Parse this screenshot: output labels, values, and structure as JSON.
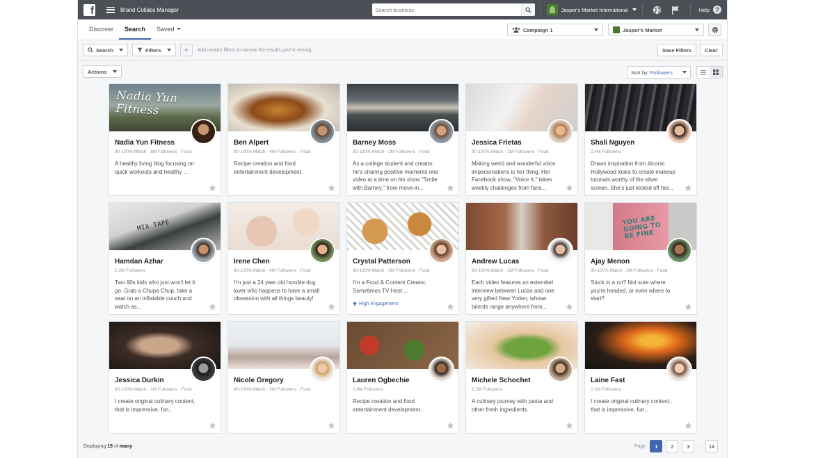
{
  "topbar": {
    "logo": "f",
    "app_title": "Brand Collabs Manager",
    "search_placeholder": "Search business",
    "account_name": "Jasper's Market International",
    "help_label": "Help",
    "help_icon": "?"
  },
  "tabs": [
    {
      "label": "Discover",
      "active": false
    },
    {
      "label": "Search",
      "active": true
    },
    {
      "label": "Saved",
      "active": false
    }
  ],
  "selectors": {
    "campaign": "Campaign 1",
    "page": "Jasper's Market"
  },
  "filterbar": {
    "search_label": "Search",
    "filters_label": "Filters",
    "add_symbol": "+",
    "hint": "Add creator filters to narrow the results you're seeing.",
    "save_filters": "Save Filters",
    "clear": "Clear"
  },
  "resultsbar": {
    "actions_label": "Actions",
    "sort_prefix": "Sort by:",
    "sort_value": "Followers"
  },
  "cards": [
    {
      "name": "Nadia Yun Fitness",
      "meta": "90-100% Match · 8M Followers · Food",
      "desc": "A healthy living blog focusing on quick workouts and healthy ...",
      "caption": "Nadia Yun Fitness",
      "tag": ""
    },
    {
      "name": "Ben Alpert",
      "meta": "90-100% Match · 4M Followers · Food",
      "desc": "Recipe creation and food entertainment development.",
      "caption": "",
      "tag": ""
    },
    {
      "name": "Barney Moss",
      "meta": "90-100% Match · 2M Followers · Food",
      "desc": "As a college student and creator, he's sharing positive moments one video at a time on his show \"Smile with Barney,\" from move-in...",
      "caption": "",
      "tag": ""
    },
    {
      "name": "Jessica Frietas",
      "meta": "90-100% Match · 2M Followers · Food",
      "desc": "Making weird and wonderful voice impersonations is her thing. Her Facebook show, \"Voice It,\" takes weekly challenges from fans...",
      "caption": "",
      "tag": ""
    },
    {
      "name": "Shali Nguyen",
      "meta": "2.4M Followers",
      "desc": "Draws inspiration from #iconic Hollywood looks to create makeup tutorials worthy of the silver screen. She's just kicked off her...",
      "caption": "",
      "tag": ""
    },
    {
      "name": "Hamdan Azhar",
      "meta": "2.2M Followers",
      "desc": "Two 90s kids who just won't let it go. Grab a Chupa Chup, take a seat on an inflatable couch and watch as...",
      "caption": "MIX TAPE",
      "tag": ""
    },
    {
      "name": "Irene Chen",
      "meta": "90-100% Match · 4M Followers · Food",
      "desc": "I'm just a 24 year old humble dog lover who happens to have a small obsession with all things beauty!",
      "caption": "",
      "tag": ""
    },
    {
      "name": "Crystal Patterson",
      "meta": "90-100% Match · 3M Followers · Food",
      "desc": "I'm a Food & Content Creator, Sometimes TV Host ...",
      "caption": "",
      "tag": "High Engagement"
    },
    {
      "name": "Andrew Lucas",
      "meta": "90-100% Match · 2M Followers · Food",
      "desc": "Each video features an extended interview between Lucas and one very gifted New Yorker, whose talents range anywhere from...",
      "caption": "",
      "tag": ""
    },
    {
      "name": "Ajay Menon",
      "meta": "90-100% Match · 2M Followers · Food",
      "desc": "Stuck in a rut? Not sure where you're headed, or even where to start?",
      "caption": "YOU ARE GOING TO BE FINE",
      "tag": ""
    },
    {
      "name": "Jessica Durkin",
      "meta": "90-100% Match · 2M Followers · Food",
      "desc": "I create original culinary content, that is impressive, fun...",
      "caption": "",
      "tag": ""
    },
    {
      "name": "Nicole Gregory",
      "meta": "90-100% Match · 2M Followers · Food",
      "desc": "",
      "caption": "",
      "tag": ""
    },
    {
      "name": "Lauren Ogbechie",
      "meta": "2.4M Followers",
      "desc": "Recipe creation and food entertainment development.",
      "caption": "",
      "tag": ""
    },
    {
      "name": "Michele Schochet",
      "meta": "2.2M Followers",
      "desc": "A culinary journey with pasta and other fresh ingredients.",
      "caption": "",
      "tag": ""
    },
    {
      "name": "Laine Fast",
      "meta": "2.2M Followers",
      "desc": "I create original culinary content, that is impressive, fun...",
      "caption": "",
      "tag": ""
    }
  ],
  "footer": {
    "displaying_prefix": "Displaying",
    "displaying_count": "15",
    "displaying_mid": "of",
    "displaying_total": "many",
    "page_label": "Page",
    "pages": [
      "1",
      "2",
      "3"
    ],
    "ellipsis": "...",
    "last_page": "14",
    "active_page": "1"
  },
  "colors": {
    "topbar": "#4b4f56",
    "accent": "#4267b2",
    "background": "#f5f6f7"
  }
}
